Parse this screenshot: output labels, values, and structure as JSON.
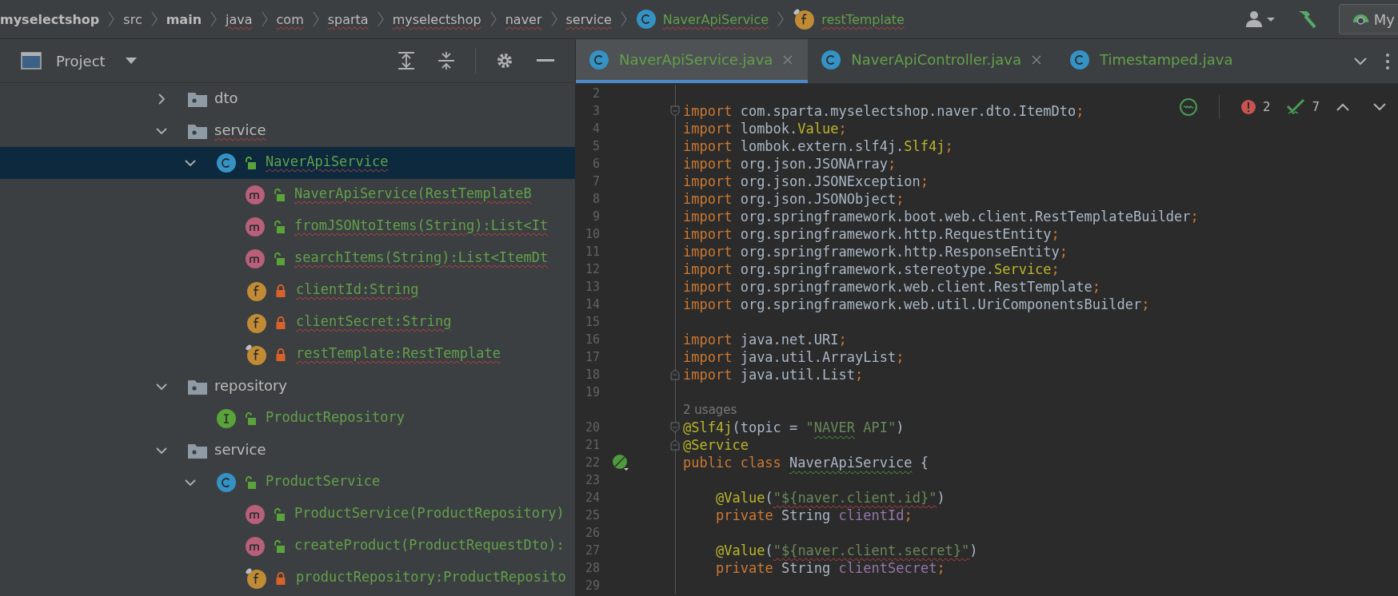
{
  "breadcrumbs": [
    {
      "label": "myselectshop",
      "kind": "plain",
      "bold": true,
      "underlined": false
    },
    {
      "label": "src",
      "kind": "plain",
      "bold": false,
      "underlined": false
    },
    {
      "label": "main",
      "kind": "plain",
      "bold": true,
      "underlined": false
    },
    {
      "label": "java",
      "kind": "plain",
      "bold": false,
      "underlined": true
    },
    {
      "label": "com",
      "kind": "plain",
      "bold": false,
      "underlined": true
    },
    {
      "label": "sparta",
      "kind": "plain",
      "bold": false,
      "underlined": true
    },
    {
      "label": "myselectshop",
      "kind": "plain",
      "bold": false,
      "underlined": true
    },
    {
      "label": "naver",
      "kind": "plain",
      "bold": false,
      "underlined": true
    },
    {
      "label": "service",
      "kind": "plain",
      "bold": false,
      "underlined": true
    },
    {
      "label": "NaverApiService",
      "kind": "class",
      "bold": false,
      "underlined": true
    },
    {
      "label": "restTemplate",
      "kind": "field",
      "badge": true,
      "bold": false,
      "underlined": true
    }
  ],
  "run_config": {
    "label": "My"
  },
  "project_panel": {
    "title": "Project"
  },
  "tree": [
    {
      "kind": "offscreen",
      "children": [
        {
          "label": "dto",
          "kind": "folder",
          "expanded": false,
          "selected": false,
          "underlined": false
        },
        {
          "label": "service",
          "kind": "folder",
          "expanded": true,
          "selected": false,
          "underlined": true,
          "children": [
            {
              "label": "NaverApiService",
              "kind": "class",
              "private": false,
              "expanded": true,
              "selected": true,
              "underlined": true,
              "children": [
                {
                  "label": "NaverApiService(RestTemplateB",
                  "kind": "method",
                  "private": false,
                  "selected": false,
                  "underlined": true
                },
                {
                  "label": "fromJSONtoItems(String):List<It",
                  "kind": "method",
                  "private": false,
                  "selected": false,
                  "underlined": true
                },
                {
                  "label": "searchItems(String):List<ItemDt",
                  "kind": "method",
                  "private": false,
                  "selected": false,
                  "underlined": true
                },
                {
                  "label": "clientId:String",
                  "kind": "field",
                  "private": true,
                  "badge": false,
                  "selected": false,
                  "underlined": true
                },
                {
                  "label": "clientSecret:String",
                  "kind": "field",
                  "private": true,
                  "badge": false,
                  "selected": false,
                  "underlined": true
                },
                {
                  "label": "restTemplate:RestTemplate",
                  "kind": "field",
                  "private": true,
                  "badge": true,
                  "selected": false,
                  "underlined": true
                }
              ]
            }
          ]
        }
      ]
    },
    {
      "label": "repository",
      "kind": "folder",
      "expanded": true,
      "selected": false,
      "underlined": false,
      "children": [
        {
          "label": "ProductRepository",
          "kind": "interface",
          "private": false,
          "selected": false,
          "underlined": false
        }
      ]
    },
    {
      "label": "service",
      "kind": "folder",
      "expanded": true,
      "selected": false,
      "underlined": false,
      "children": [
        {
          "label": "ProductService",
          "kind": "class",
          "private": false,
          "expanded": true,
          "selected": false,
          "underlined": false,
          "children": [
            {
              "label": "ProductService(ProductRepository)",
              "kind": "method",
              "private": false,
              "selected": false,
              "underlined": false
            },
            {
              "label": "createProduct(ProductRequestDto):",
              "kind": "method",
              "private": false,
              "selected": false,
              "underlined": false
            },
            {
              "label": "productRepository:ProductReposito",
              "kind": "field",
              "private": true,
              "badge": true,
              "selected": false,
              "underlined": false
            }
          ]
        }
      ]
    }
  ],
  "tabs": [
    {
      "label": "NaverApiService.java",
      "selected": true,
      "closable": true
    },
    {
      "label": "NaverApiController.java",
      "selected": false,
      "closable": true
    },
    {
      "label": "Timestamped.java",
      "selected": false,
      "closable": false
    }
  ],
  "inspections": {
    "errors": "2",
    "warnings": "7"
  },
  "lines": [
    {
      "kind": "code",
      "number": "2"
    },
    {
      "kind": "code",
      "number": "3",
      "gutter": {
        "kind": "fold-start"
      },
      "tokens": [
        {
          "kind": "keyword",
          "text": "import"
        },
        {
          "kind": "plain",
          "text": " com.sparta.myselectshop.naver.dto.ItemDto"
        },
        {
          "kind": "punct",
          "text": ";"
        }
      ]
    },
    {
      "kind": "code",
      "number": "4",
      "tokens": [
        {
          "kind": "keyword",
          "text": "import"
        },
        {
          "kind": "plain",
          "text": " lombok."
        },
        {
          "kind": "annotation",
          "text": "Value"
        },
        {
          "kind": "punct",
          "text": ";"
        }
      ]
    },
    {
      "kind": "code",
      "number": "5",
      "tokens": [
        {
          "kind": "keyword",
          "text": "import"
        },
        {
          "kind": "plain",
          "text": " lombok.extern.slf4j."
        },
        {
          "kind": "annotation",
          "text": "Slf4j"
        },
        {
          "kind": "punct",
          "text": ";"
        }
      ]
    },
    {
      "kind": "code",
      "number": "6",
      "tokens": [
        {
          "kind": "keyword",
          "text": "import"
        },
        {
          "kind": "plain",
          "text": " org.json.JSONArray"
        },
        {
          "kind": "punct",
          "text": ";"
        }
      ]
    },
    {
      "kind": "code",
      "number": "7",
      "tokens": [
        {
          "kind": "keyword",
          "text": "import"
        },
        {
          "kind": "plain",
          "text": " org.json.JSONException"
        },
        {
          "kind": "punct",
          "text": ";"
        }
      ]
    },
    {
      "kind": "code",
      "number": "8",
      "tokens": [
        {
          "kind": "keyword",
          "text": "import"
        },
        {
          "kind": "plain",
          "text": " org.json.JSONObject"
        },
        {
          "kind": "punct",
          "text": ";"
        }
      ]
    },
    {
      "kind": "code",
      "number": "9",
      "tokens": [
        {
          "kind": "keyword",
          "text": "import"
        },
        {
          "kind": "plain",
          "text": " org.springframework.boot.web.client.RestTemplateBuilder"
        },
        {
          "kind": "punct",
          "text": ";"
        }
      ]
    },
    {
      "kind": "code",
      "number": "10",
      "tokens": [
        {
          "kind": "keyword",
          "text": "import"
        },
        {
          "kind": "plain",
          "text": " org.springframework.http.RequestEntity"
        },
        {
          "kind": "punct",
          "text": ";"
        }
      ]
    },
    {
      "kind": "code",
      "number": "11",
      "tokens": [
        {
          "kind": "keyword",
          "text": "import"
        },
        {
          "kind": "plain",
          "text": " org.springframework.http.ResponseEntity"
        },
        {
          "kind": "punct",
          "text": ";"
        }
      ]
    },
    {
      "kind": "code",
      "number": "12",
      "tokens": [
        {
          "kind": "keyword",
          "text": "import"
        },
        {
          "kind": "plain",
          "text": " org.springframework.stereotype."
        },
        {
          "kind": "annotation",
          "text": "Service"
        },
        {
          "kind": "punct",
          "text": ";"
        }
      ]
    },
    {
      "kind": "code",
      "number": "13",
      "tokens": [
        {
          "kind": "keyword",
          "text": "import"
        },
        {
          "kind": "plain",
          "text": " org.springframework.web.client.RestTemplate"
        },
        {
          "kind": "punct",
          "text": ";"
        }
      ]
    },
    {
      "kind": "code",
      "number": "14",
      "tokens": [
        {
          "kind": "keyword",
          "text": "import"
        },
        {
          "kind": "plain",
          "text": " org.springframework.web.util.UriComponentsBuilder"
        },
        {
          "kind": "punct",
          "text": ";"
        }
      ]
    },
    {
      "kind": "code",
      "number": "15"
    },
    {
      "kind": "code",
      "number": "16",
      "tokens": [
        {
          "kind": "keyword",
          "text": "import"
        },
        {
          "kind": "plain",
          "text": " java.net.URI"
        },
        {
          "kind": "punct",
          "text": ";"
        }
      ]
    },
    {
      "kind": "code",
      "number": "17",
      "tokens": [
        {
          "kind": "keyword",
          "text": "import"
        },
        {
          "kind": "plain",
          "text": " java.util.ArrayList"
        },
        {
          "kind": "punct",
          "text": ";"
        }
      ]
    },
    {
      "kind": "code",
      "number": "18",
      "gutter": {
        "kind": "fold-end"
      },
      "tokens": [
        {
          "kind": "keyword",
          "text": "import"
        },
        {
          "kind": "plain",
          "text": " java.util.List"
        },
        {
          "kind": "punct",
          "text": ";"
        }
      ]
    },
    {
      "kind": "code",
      "number": "19"
    },
    {
      "kind": "hint",
      "text": "2 usages"
    },
    {
      "kind": "code",
      "number": "20",
      "gutter": {
        "kind": "fold-start"
      },
      "tokens": [
        {
          "kind": "annotation",
          "text": "@Slf4j"
        },
        {
          "kind": "plain",
          "text": "(topic = "
        },
        {
          "kind": "string",
          "text": "\""
        },
        {
          "kind": "string",
          "text": "NAVER",
          "underline": {
            "kind": "weak"
          }
        },
        {
          "kind": "string",
          "text": " API\""
        },
        {
          "kind": "plain",
          "text": ")"
        }
      ]
    },
    {
      "kind": "code",
      "number": "21",
      "gutter": {
        "kind": "fold-end"
      },
      "tokens": [
        {
          "kind": "annotation",
          "text": "@Service"
        }
      ]
    },
    {
      "kind": "code",
      "number": "22",
      "gutter": {
        "kind": "bean"
      },
      "tokens": [
        {
          "kind": "keyword",
          "text": "public class "
        },
        {
          "kind": "plain",
          "text": "NaverApiService",
          "underline": {
            "kind": "weak"
          }
        },
        {
          "kind": "plain",
          "text": " {"
        }
      ],
      "body": [
        {
          "kind": "code",
          "number": "23"
        },
        {
          "kind": "code",
          "number": "24",
          "tokens": [
            {
              "kind": "annotation",
              "text": "@Value"
            },
            {
              "kind": "plain",
              "text": "("
            },
            {
              "kind": "string",
              "text": "\"${naver.client.id}\"",
              "underline": {
                "kind": "error"
              }
            },
            {
              "kind": "plain",
              "text": ")"
            }
          ]
        },
        {
          "kind": "code",
          "number": "25",
          "tokens": [
            {
              "kind": "keyword",
              "text": "private "
            },
            {
              "kind": "plain",
              "text": "String "
            },
            {
              "kind": "field",
              "text": "clientId"
            },
            {
              "kind": "punct",
              "text": ";"
            }
          ]
        },
        {
          "kind": "code",
          "number": "26"
        },
        {
          "kind": "code",
          "number": "27",
          "tokens": [
            {
              "kind": "annotation",
              "text": "@Value"
            },
            {
              "kind": "plain",
              "text": "("
            },
            {
              "kind": "string",
              "text": "\"${naver.client.secret}\"",
              "underline": {
                "kind": "error"
              }
            },
            {
              "kind": "plain",
              "text": ")"
            }
          ]
        },
        {
          "kind": "code",
          "number": "28",
          "tokens": [
            {
              "kind": "keyword",
              "text": "private "
            },
            {
              "kind": "plain",
              "text": "String "
            },
            {
              "kind": "field",
              "text": "clientSecret"
            },
            {
              "kind": "punct",
              "text": ";"
            }
          ]
        },
        {
          "kind": "code",
          "number": "29"
        }
      ]
    }
  ]
}
